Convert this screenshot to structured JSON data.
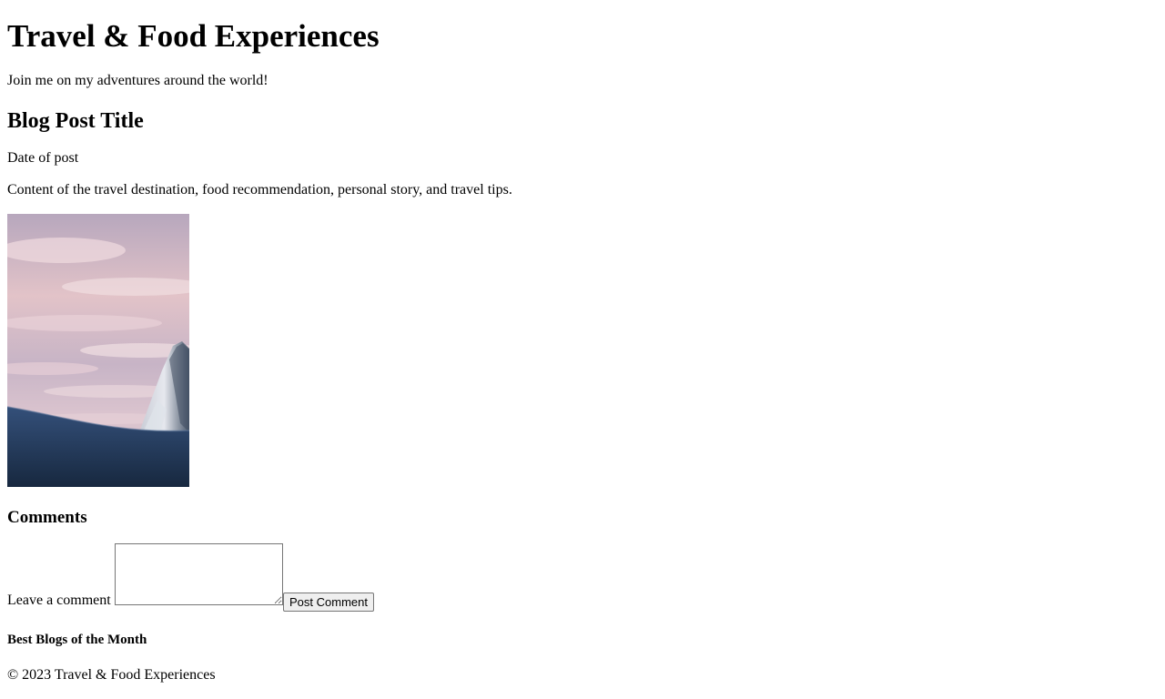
{
  "header": {
    "title": "Travel & Food Experiences",
    "tagline": "Join me on my adventures around the world!"
  },
  "post": {
    "title": "Blog Post Title",
    "date": "Date of post",
    "content": "Content of the travel destination, food recommendation, personal story, and travel tips.",
    "image": {
      "icon": "mountain-photo",
      "colors": {
        "sky_top": "#b9a9bf",
        "sky_pink": "#e6c4c9",
        "sky_blue": "#a9a6c4",
        "mountain_dark": "#3c4a5e",
        "snow": "#e7e9ee",
        "ground": "#1f3552"
      }
    }
  },
  "comments": {
    "heading": "Comments",
    "label": "Leave a comment",
    "textarea_value": "",
    "submit_label": "Post Comment"
  },
  "aside": {
    "best_blogs_heading": "Best Blogs of the Month"
  },
  "footer": {
    "text": "© 2023 Travel & Food Experiences"
  }
}
